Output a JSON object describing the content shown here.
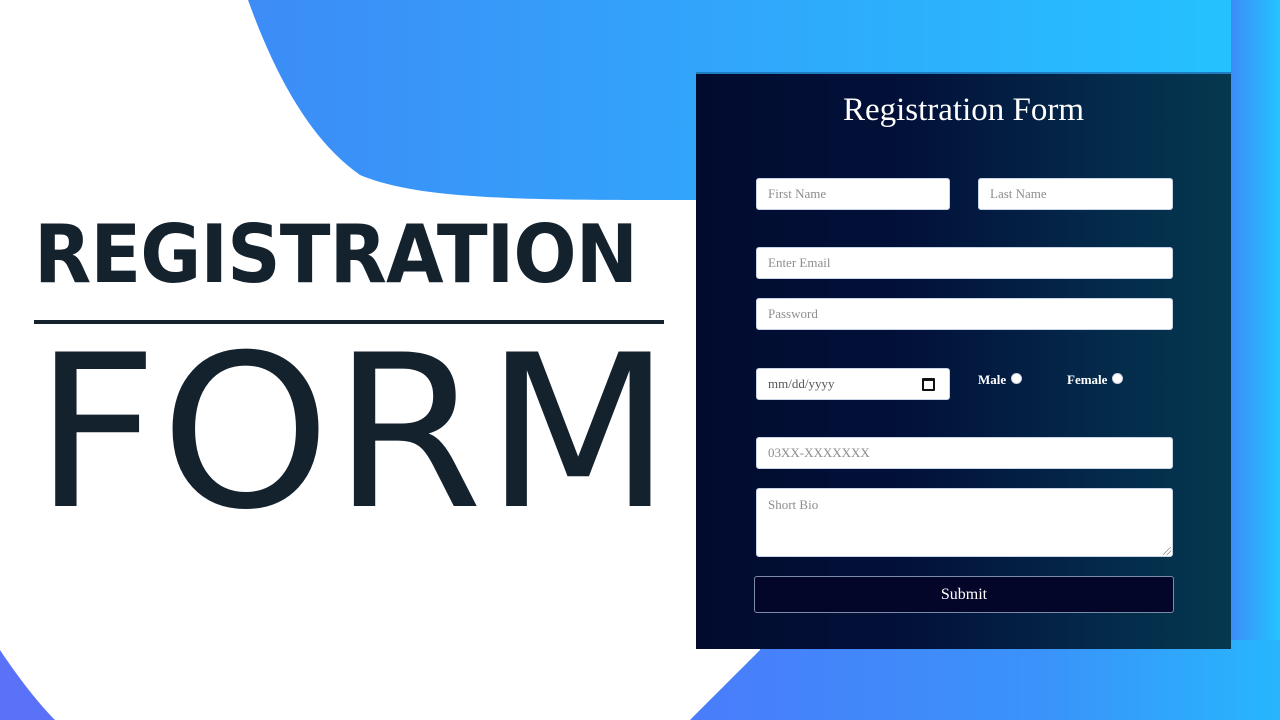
{
  "hero": {
    "title_line1": "REGISTRATION",
    "title_line2": "FORM"
  },
  "form": {
    "title": "Registration Form",
    "fields": {
      "first_name": {
        "placeholder": "First Name",
        "value": ""
      },
      "last_name": {
        "placeholder": "Last Name",
        "value": ""
      },
      "email": {
        "placeholder": "Enter Email",
        "value": ""
      },
      "password": {
        "placeholder": "Password",
        "value": ""
      },
      "date": {
        "placeholder": "mm/dd/yyyy",
        "value": ""
      },
      "phone": {
        "placeholder": "03XX-XXXXXXX",
        "value": ""
      },
      "bio": {
        "placeholder": "Short Bio",
        "value": ""
      }
    },
    "gender": {
      "options": [
        {
          "label": "Male",
          "selected": false
        },
        {
          "label": "Female",
          "selected": false
        }
      ]
    },
    "submit_label": "Submit"
  },
  "colors": {
    "hero_text": "#14222e",
    "blob_left": "#3d8cf7",
    "blob_right": "#27bdfd",
    "card_dark": "#020b2e",
    "card_teal": "#05384f",
    "button_bg": "#030628"
  },
  "icons": {
    "date_picker": "calendar-icon"
  }
}
